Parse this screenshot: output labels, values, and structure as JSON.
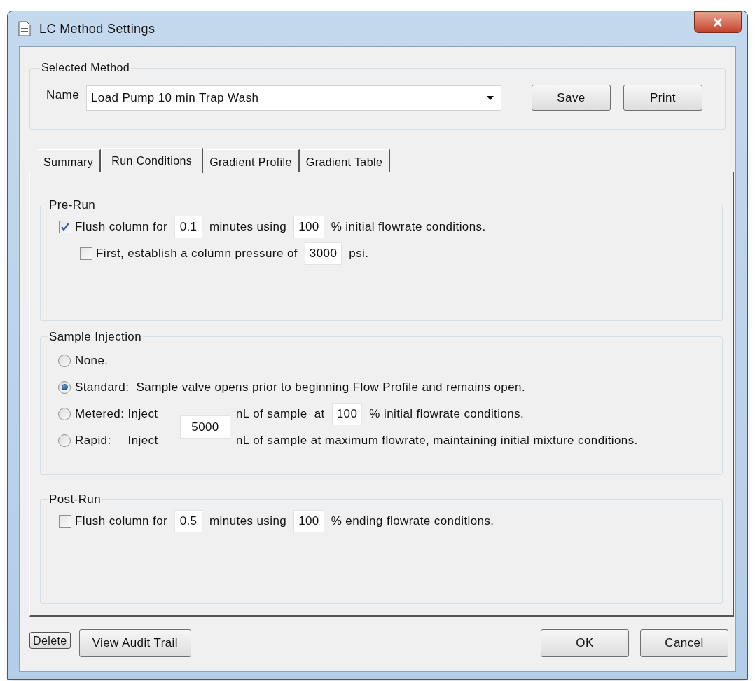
{
  "window": {
    "title": "LC Method Settings"
  },
  "selected_method": {
    "legend": "Selected Method",
    "name_label": "Name",
    "name_value": "Load Pump 10 min Trap Wash",
    "buttons": [
      "Save",
      "Print"
    ]
  },
  "tabs": [
    {
      "label": "Summary",
      "selected": false
    },
    {
      "label": "Run Conditions",
      "selected": true
    },
    {
      "label": "Gradient Profile",
      "selected": false
    },
    {
      "label": "Gradient Table",
      "selected": false
    }
  ],
  "pre_run": {
    "legend": "Pre-Run",
    "rows": [
      {
        "checked": true,
        "label": "Flush column for",
        "segments": [
          {
            "kind": "field",
            "value": "0.1"
          },
          {
            "kind": "text",
            "text": "minutes using"
          },
          {
            "kind": "field",
            "value": "100"
          },
          {
            "kind": "text",
            "text": "% initial flowrate conditions."
          }
        ],
        "children": [
          {
            "checked": false,
            "label": "First, establish a column pressure of",
            "segments": [
              {
                "kind": "field",
                "value": "3000"
              },
              {
                "kind": "text",
                "text": "psi."
              }
            ]
          }
        ]
      }
    ]
  },
  "sample_injection": {
    "legend": "Sample Injection",
    "options": [
      {
        "kind": "simple",
        "label": "None.",
        "selected": false
      },
      {
        "kind": "simple",
        "label": "Standard:  Sample valve opens prior to beginning Flow Profile and remains open.",
        "selected": true
      },
      {
        "kind": "shared",
        "label": "Metered: Inject",
        "selected": false,
        "segments": [
          {
            "kind": "text",
            "text": "nL of sample  at"
          },
          {
            "kind": "field",
            "value": "100"
          },
          {
            "kind": "text",
            "text": "% initial flowrate conditions."
          }
        ]
      },
      {
        "kind": "shared",
        "label": "Rapid:",
        "extra": "Inject",
        "selected": false,
        "segments": [
          {
            "kind": "text",
            "text": "nL of sample at maximum flowrate, maintaining initial mixture conditions."
          }
        ]
      }
    ],
    "shared_volume": "5000"
  },
  "post_run": {
    "legend": "Post-Run",
    "rows": [
      {
        "checked": false,
        "label": "Flush column for",
        "segments": [
          {
            "kind": "field",
            "value": "0.5"
          },
          {
            "kind": "text",
            "text": "minutes using"
          },
          {
            "kind": "field",
            "value": "100"
          },
          {
            "kind": "text",
            "text": "% ending flowrate conditions."
          }
        ]
      }
    ]
  },
  "footer": {
    "left_buttons": [
      "Delete",
      "View Audit Trail"
    ],
    "right_buttons": [
      "OK",
      "Cancel"
    ]
  }
}
